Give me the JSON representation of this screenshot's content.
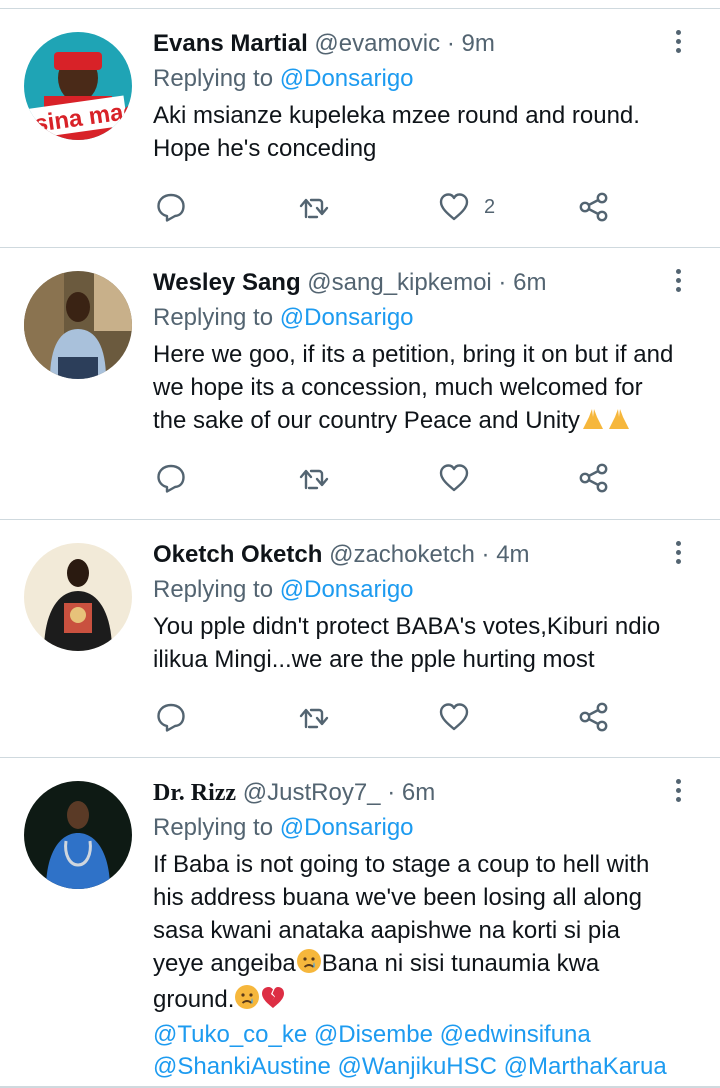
{
  "reply_prefix": "Replying to",
  "tweets": [
    {
      "name": "Evans Martial",
      "handle": "@evamovic",
      "separator": "·",
      "time": "9m",
      "reply_to": "@Donsarigo",
      "lines": [
        "Aki msianze kupeleka mzee round and round.",
        "Hope he's conceding"
      ],
      "avatar_text": "sina maoni",
      "likes": "2"
    },
    {
      "name": "Wesley Sang",
      "handle": "@sang_kipkemoi",
      "separator": "·",
      "time": "6m",
      "reply_to": "@Donsarigo",
      "lines": [
        "Here we goo, if its a petition, bring it on but if and",
        "we hope its a concession, much welcomed for",
        "the sake of our country Peace and Unity"
      ],
      "likes": ""
    },
    {
      "name": "Oketch Oketch",
      "handle": "@zachoketch",
      "separator": "·",
      "time": "4m",
      "reply_to": "@Donsarigo",
      "lines": [
        "You pple didn't protect BABA's votes,Kiburi ndio",
        "ilikua Mingi...we are the pple hurting most"
      ],
      "likes": ""
    },
    {
      "name": "Dr. Rizz",
      "handle": "@JustRoy7_",
      "separator": "·",
      "time": "6m",
      "reply_to": "@Donsarigo",
      "lines": [
        "If Baba is not going to stage a coup to hell with",
        "his address buana we've been losing all along",
        "sasa kwani anataka aapishwe na korti si pia",
        "yeye angeiba",
        "Bana ni sisi tunaumia kwa",
        "ground."
      ],
      "mentions_line1": "@Tuko_co_ke @Disembe @edwinsifuna",
      "mentions_line2": "@ShankiAustine @WanjikuHSC @MarthaKarua"
    }
  ],
  "icons": {
    "reply": "reply-icon",
    "retweet": "retweet-icon",
    "like": "heart-icon",
    "share": "share-icon",
    "more": "more-vertical-icon"
  },
  "colors": {
    "link": "#1d9bf0",
    "secondary": "#536471",
    "divider": "#cfd9de"
  }
}
